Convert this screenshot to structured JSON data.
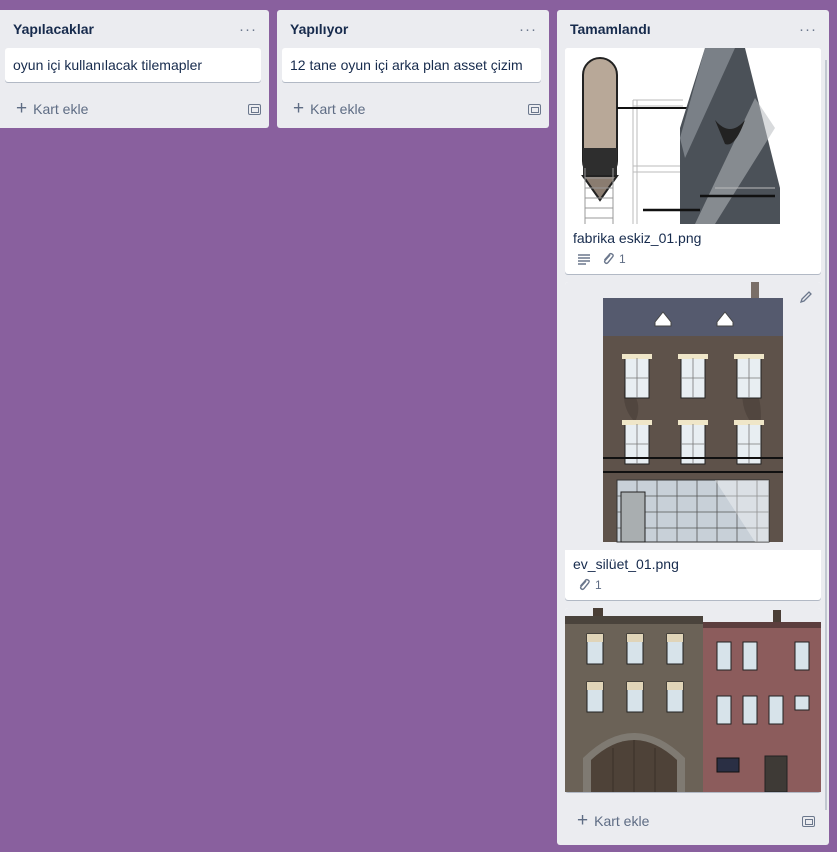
{
  "lists": [
    {
      "title": "Yapılacaklar",
      "cards": [
        {
          "text": "oyun içi kullanılacak tilemapler"
        }
      ],
      "add_label": "Kart ekle"
    },
    {
      "title": "Yapılıyor",
      "cards": [
        {
          "text": "12 tane oyun içi arka plan asset çizim"
        }
      ],
      "add_label": "Kart ekle"
    },
    {
      "title": "Tamamlandı",
      "cards": [
        {
          "title": "fabrika eskiz_01.png",
          "attachments": "1",
          "has_description": true
        },
        {
          "title": "ev_silüet_01.png",
          "attachments": "1"
        },
        {
          "title": ""
        }
      ],
      "add_label": "Kart ekle"
    }
  ],
  "menu_glyph": "···",
  "colors": {
    "board_bg": "#89609e",
    "list_bg": "#ebecf0",
    "text": "#172b4d",
    "muted": "#5e6c84"
  }
}
